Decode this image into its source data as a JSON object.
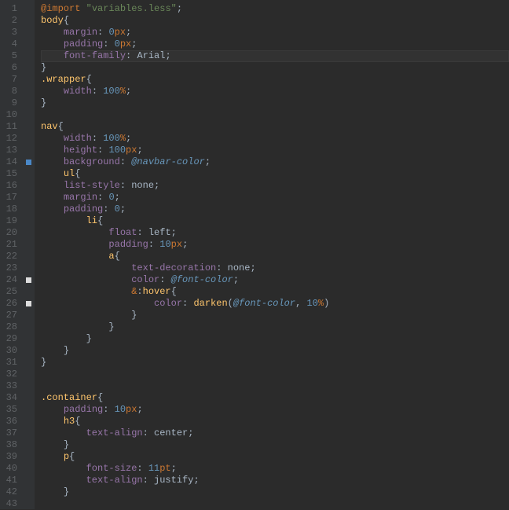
{
  "editor": {
    "lines": [
      {
        "n": 1,
        "html": "<span class='kw'>@import</span> <span class='str'>\"variables.less\"</span><span class='punc'>;</span>"
      },
      {
        "n": 2,
        "html": "<span class='tag'>body</span><span class='punc'>{</span>"
      },
      {
        "n": 3,
        "html": "    <span class='prop'>margin</span><span class='punc'>:</span> <span class='num'>0</span><span class='unit'>px</span><span class='punc'>;</span>"
      },
      {
        "n": 4,
        "html": "    <span class='prop'>padding</span><span class='punc'>:</span> <span class='num'>0</span><span class='unit'>px</span><span class='punc'>;</span>"
      },
      {
        "n": 5,
        "hl": true,
        "html": "    <span class='prop'>font-family</span><span class='punc'>:</span> <span class='val'>Arial</span><span class='punc'>;</span>"
      },
      {
        "n": 6,
        "html": "<span class='punc'>}</span>"
      },
      {
        "n": 7,
        "html": "<span class='sel'>.wrapper</span><span class='punc'>{</span>"
      },
      {
        "n": 8,
        "html": "    <span class='prop'>width</span><span class='punc'>:</span> <span class='num'>100</span><span class='unit'>%</span><span class='punc'>;</span>"
      },
      {
        "n": 9,
        "html": "<span class='punc'>}</span>"
      },
      {
        "n": 10,
        "html": ""
      },
      {
        "n": 11,
        "html": "<span class='tag'>nav</span><span class='punc'>{</span>"
      },
      {
        "n": 12,
        "html": "    <span class='prop'>width</span><span class='punc'>:</span> <span class='num'>100</span><span class='unit'>%</span><span class='punc'>;</span>"
      },
      {
        "n": 13,
        "html": "    <span class='prop'>height</span><span class='punc'>:</span> <span class='num'>100</span><span class='unit'>px</span><span class='punc'>;</span>"
      },
      {
        "n": 14,
        "mark": "blue",
        "html": "    <span class='prop'>background</span><span class='punc'>:</span> <span class='var'>@navbar-color</span><span class='punc'>;</span>"
      },
      {
        "n": 15,
        "html": "    <span class='tag'>ul</span><span class='punc'>{</span>"
      },
      {
        "n": 16,
        "html": "    <span class='prop'>list-style</span><span class='punc'>:</span> <span class='val'>none</span><span class='punc'>;</span>"
      },
      {
        "n": 17,
        "html": "    <span class='prop'>margin</span><span class='punc'>:</span> <span class='num'>0</span><span class='punc'>;</span>"
      },
      {
        "n": 18,
        "html": "    <span class='prop'>padding</span><span class='punc'>:</span> <span class='num'>0</span><span class='punc'>;</span>"
      },
      {
        "n": 19,
        "html": "        <span class='tag'>li</span><span class='punc'>{</span>"
      },
      {
        "n": 20,
        "html": "            <span class='prop'>float</span><span class='punc'>:</span> <span class='val'>left</span><span class='punc'>;</span>"
      },
      {
        "n": 21,
        "html": "            <span class='prop'>padding</span><span class='punc'>:</span> <span class='num'>10</span><span class='unit'>px</span><span class='punc'>;</span>"
      },
      {
        "n": 22,
        "html": "            <span class='tag'>a</span><span class='punc'>{</span>"
      },
      {
        "n": 23,
        "html": "                <span class='prop'>text-decoration</span><span class='punc'>:</span> <span class='val'>none</span><span class='punc'>;</span>"
      },
      {
        "n": 24,
        "mark": "white",
        "html": "                <span class='prop'>color</span><span class='punc'>:</span> <span class='var'>@font-color</span><span class='punc'>;</span>"
      },
      {
        "n": 25,
        "html": "                <span class='amp'>&amp;</span><span class='punc'>:</span><span class='tag'>hover</span><span class='punc'>{</span>"
      },
      {
        "n": 26,
        "mark": "white",
        "html": "                    <span class='prop'>color</span><span class='punc'>:</span> <span class='fn'>darken</span><span class='punc'>(</span><span class='var'>@font-color</span><span class='punc'>,</span> <span class='num'>10</span><span class='unit'>%</span><span class='punc'>)</span>"
      },
      {
        "n": 27,
        "html": "                <span class='punc'>}</span>"
      },
      {
        "n": 28,
        "html": "            <span class='punc'>}</span>"
      },
      {
        "n": 29,
        "html": "        <span class='punc'>}</span>"
      },
      {
        "n": 30,
        "html": "    <span class='punc'>}</span>"
      },
      {
        "n": 31,
        "html": "<span class='punc'>}</span>"
      },
      {
        "n": 32,
        "html": ""
      },
      {
        "n": 33,
        "html": ""
      },
      {
        "n": 34,
        "html": "<span class='sel'>.container</span><span class='punc'>{</span>"
      },
      {
        "n": 35,
        "html": "    <span class='prop'>padding</span><span class='punc'>:</span> <span class='num'>10</span><span class='unit'>px</span><span class='punc'>;</span>"
      },
      {
        "n": 36,
        "html": "    <span class='tag'>h3</span><span class='punc'>{</span>"
      },
      {
        "n": 37,
        "html": "        <span class='prop'>text-align</span><span class='punc'>:</span> <span class='val'>center</span><span class='punc'>;</span>"
      },
      {
        "n": 38,
        "html": "    <span class='punc'>}</span>"
      },
      {
        "n": 39,
        "html": "    <span class='tag'>p</span><span class='punc'>{</span>"
      },
      {
        "n": 40,
        "html": "        <span class='prop'>font-size</span><span class='punc'>:</span> <span class='num'>11</span><span class='unit'>pt</span><span class='punc'>;</span>"
      },
      {
        "n": 41,
        "html": "        <span class='prop'>text-align</span><span class='punc'>:</span> <span class='val'>justify</span><span class='punc'>;</span>"
      },
      {
        "n": 42,
        "html": "    <span class='punc'>}</span>"
      },
      {
        "n": 43,
        "html": ""
      }
    ]
  }
}
